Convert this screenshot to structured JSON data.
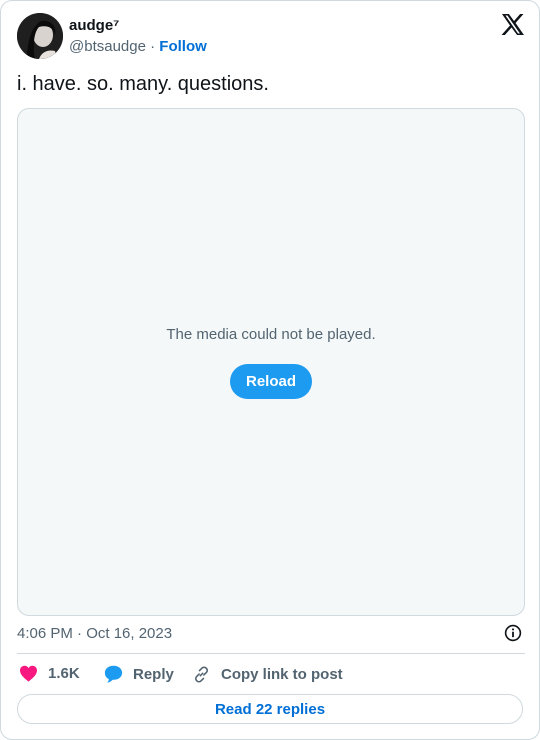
{
  "author": {
    "display_name": "audge⁷",
    "handle": "@btsaudge",
    "separator": "·",
    "follow_label": "Follow"
  },
  "tweet": {
    "text": "i. have. so. many. questions.",
    "timestamp": "4:06 PM · Oct 16, 2023"
  },
  "media": {
    "error_message": "The media could not be played.",
    "reload_label": "Reload"
  },
  "actions": {
    "like_count": "1.6K",
    "reply_label": "Reply",
    "copy_link_label": "Copy link to post",
    "read_replies_label": "Read 22 replies"
  },
  "icons": {
    "logo": "x-logo-icon",
    "like": "heart-icon",
    "reply": "speech-bubble-icon",
    "copy": "link-icon",
    "info": "info-icon"
  },
  "colors": {
    "accent": "#1d9bf0",
    "link": "#006fd6",
    "like": "#f91880",
    "muted_text": "#536471",
    "border": "#cfd9de"
  }
}
